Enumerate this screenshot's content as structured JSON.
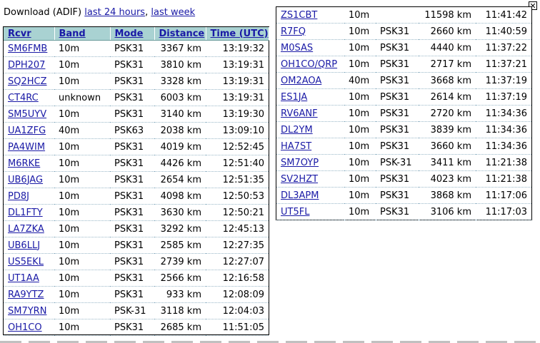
{
  "download": {
    "label": "Download (ADIF)",
    "link_24h": "last 24 hours",
    "separator": ",",
    "link_week": "last week"
  },
  "close_icon": "close-icon",
  "left_table": {
    "headers": [
      "Rcvr",
      "Band",
      "Mode",
      "Distance",
      "Time (UTC)"
    ],
    "rows": [
      [
        "SM6FMB",
        "10m",
        "PSK31",
        "3367 km",
        "13:19:32"
      ],
      [
        "DPH207",
        "10m",
        "PSK31",
        "3810 km",
        "13:19:31"
      ],
      [
        "SQ2HCZ",
        "10m",
        "PSK31",
        "3328 km",
        "13:19:31"
      ],
      [
        "CT4RC",
        "unknown",
        "PSK31",
        "6003 km",
        "13:19:31"
      ],
      [
        "SM5UYV",
        "10m",
        "PSK31",
        "3140 km",
        "13:19:30"
      ],
      [
        "UA1ZFG",
        "40m",
        "PSK63",
        "2038 km",
        "13:09:10"
      ],
      [
        "PA4WIM",
        "10m",
        "PSK31",
        "4019 km",
        "12:52:45"
      ],
      [
        "M6RKE",
        "10m",
        "PSK31",
        "4426 km",
        "12:51:40"
      ],
      [
        "UB6JAG",
        "10m",
        "PSK31",
        "2654 km",
        "12:51:35"
      ],
      [
        "PD8J",
        "10m",
        "PSK31",
        "4098 km",
        "12:50:53"
      ],
      [
        "DL1FTY",
        "10m",
        "PSK31",
        "3630 km",
        "12:50:21"
      ],
      [
        "LA7ZKA",
        "10m",
        "PSK31",
        "3292 km",
        "12:45:13"
      ],
      [
        "UB6LLJ",
        "10m",
        "PSK31",
        "2585 km",
        "12:27:35"
      ],
      [
        "US5EKL",
        "10m",
        "PSK31",
        "2739 km",
        "12:27:07"
      ],
      [
        "UT1AA",
        "10m",
        "PSK31",
        "2566 km",
        "12:16:58"
      ],
      [
        "RA9YTZ",
        "10m",
        "PSK31",
        "933 km",
        "12:08:09"
      ],
      [
        "SM7YRN",
        "10m",
        "PSK-31",
        "3118 km",
        "12:04:03"
      ],
      [
        "OH1CO",
        "10m",
        "PSK31",
        "2685 km",
        "11:51:05"
      ]
    ]
  },
  "right_table": {
    "rows": [
      [
        "ZS1CBT",
        "10m",
        "",
        "11598 km",
        "11:41:42"
      ],
      [
        "R7FQ",
        "10m",
        "PSK31",
        "2660 km",
        "11:40:59"
      ],
      [
        "M0SAS",
        "10m",
        "PSK31",
        "4440 km",
        "11:37:22"
      ],
      [
        "OH1CO/QRP",
        "10m",
        "PSK31",
        "2717 km",
        "11:37:21"
      ],
      [
        "OM2AOA",
        "40m",
        "PSK31",
        "3668 km",
        "11:37:19"
      ],
      [
        "ES1JA",
        "10m",
        "PSK31",
        "2614 km",
        "11:37:19"
      ],
      [
        "RV6ANF",
        "10m",
        "PSK31",
        "2720 km",
        "11:34:36"
      ],
      [
        "DL2YM",
        "10m",
        "PSK31",
        "3839 km",
        "11:34:36"
      ],
      [
        "HA7ST",
        "10m",
        "PSK31",
        "3660 km",
        "11:34:36"
      ],
      [
        "SM7OYP",
        "10m",
        "PSK-31",
        "3411 km",
        "11:21:38"
      ],
      [
        "SV2HZT",
        "10m",
        "PSK31",
        "4023 km",
        "11:21:38"
      ],
      [
        "DL3APM",
        "10m",
        "PSK31",
        "3868 km",
        "11:17:06"
      ],
      [
        "UT5FL",
        "10m",
        "PSK31",
        "3106 km",
        "11:17:03"
      ]
    ]
  },
  "colors": {
    "header_bg": "#a9d2d2",
    "link": "#1a1aa6",
    "row_separator": "#9ab8c8"
  }
}
